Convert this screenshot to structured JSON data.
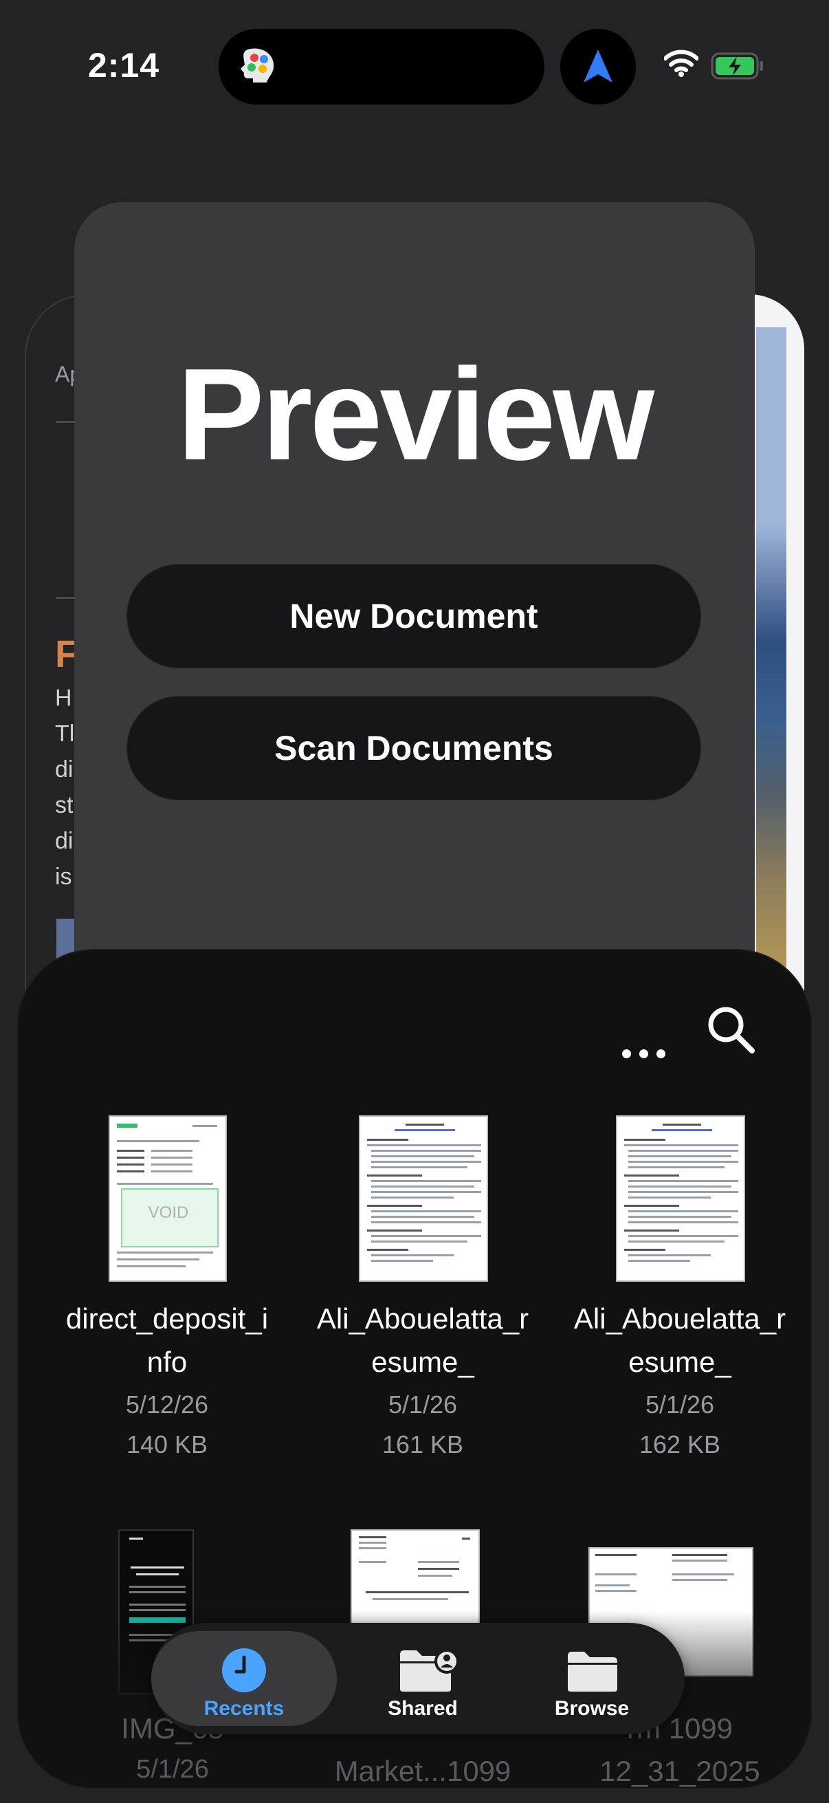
{
  "status_bar": {
    "time": "2:14"
  },
  "background_left": {
    "small_text": "Ap",
    "heading": "F",
    "body_lines": [
      "H",
      "Tl",
      "di",
      "st",
      "di",
      "is"
    ]
  },
  "preview": {
    "title": "Preview",
    "new_document_label": "New Document",
    "scan_documents_label": "Scan Documents"
  },
  "files": [
    {
      "name_line1": "direct_deposit_i",
      "name_line2": "nfo",
      "date": "5/12/26",
      "size": "140 KB",
      "void_text": "VOID"
    },
    {
      "name_line1": "Ali_Abouelatta_r",
      "name_line2": "esume_",
      "date": "5/1/26",
      "size": "161 KB"
    },
    {
      "name_line1": "Ali_Abouelatta_r",
      "name_line2": "esume_",
      "date": "5/1/26",
      "size": "162 KB"
    },
    {
      "name_line1": "IMG_65",
      "name_line2": "5/1/26"
    },
    {
      "name_line1": "Market...1099"
    },
    {
      "name_line1": "rm 1099",
      "name_line2": "12_31_2025"
    }
  ],
  "tabs": {
    "recents": "Recents",
    "shared": "Shared",
    "browse": "Browse"
  },
  "colors": {
    "accent": "#4aa3ff",
    "sheet": "#3a3a3c",
    "panel": "#111112"
  }
}
